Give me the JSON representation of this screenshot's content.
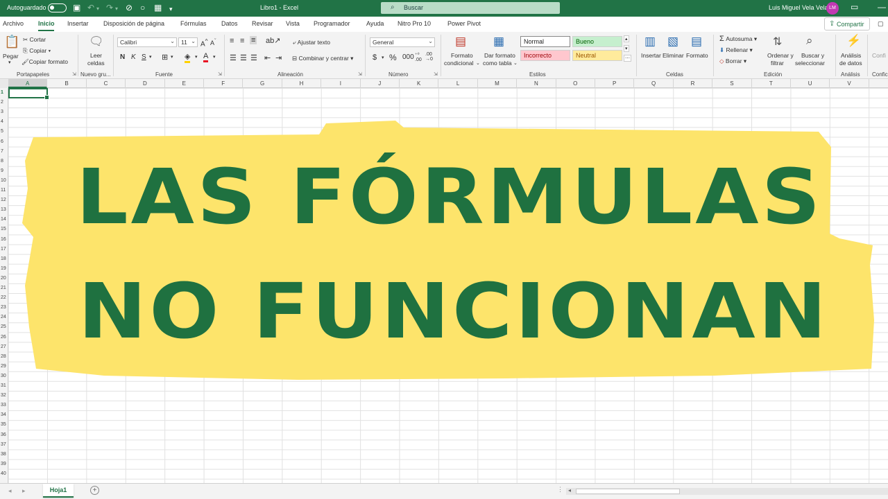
{
  "titlebar": {
    "autosave_label": "Autoguardado",
    "doc_title": "Libro1  -  Excel",
    "search_placeholder": "Buscar",
    "user_name": "Luis Miguel Vela Vela",
    "avatar_initials": "LM"
  },
  "tabs": [
    "Archivo",
    "Inicio",
    "Insertar",
    "Disposición de página",
    "Fórmulas",
    "Datos",
    "Revisar",
    "Vista",
    "Programador",
    "Ayuda",
    "Nitro Pro 10",
    "Power Pivot"
  ],
  "active_tab": "Inicio",
  "share_label": "Compartir",
  "ribbon": {
    "clipboard": {
      "paste": "Pegar",
      "cut": "Cortar",
      "copy": "Copiar",
      "format_painter": "Copiar formato",
      "group": "Portapapeles"
    },
    "new_group": {
      "read_cells_1": "Leer",
      "read_cells_2": "celdas",
      "group": "Nuevo gru..."
    },
    "font": {
      "font_name": "Calibri",
      "font_size": "11",
      "bold": "N",
      "italic": "K",
      "underline": "S",
      "group": "Fuente"
    },
    "alignment": {
      "wrap": "Ajustar texto",
      "merge": "Combinar y centrar",
      "group": "Alineación"
    },
    "number": {
      "format": "General",
      "group": "Número"
    },
    "styles": {
      "cond_format_1": "Formato",
      "cond_format_2": "condicional",
      "table_format_1": "Dar formato",
      "table_format_2": "como tabla",
      "normal": "Normal",
      "good": "Bueno",
      "bad": "Incorrecto",
      "neutral": "Neutral",
      "group": "Estilos"
    },
    "cells": {
      "insert": "Insertar",
      "delete": "Eliminar",
      "format": "Formato",
      "group": "Celdas"
    },
    "editing": {
      "autosum": "Autosuma",
      "fill": "Rellenar",
      "clear": "Borrar",
      "sort_1": "Ordenar y",
      "sort_2": "filtrar",
      "find_1": "Buscar y",
      "find_2": "seleccionar",
      "group": "Edición"
    },
    "analysis": {
      "analyze_1": "Análisis",
      "analyze_2": "de datos",
      "group": "Análisis"
    },
    "confidentiality": {
      "cut_label": "Confi",
      "group": "Confic"
    }
  },
  "columns": [
    "A",
    "B",
    "C",
    "D",
    "E",
    "F",
    "G",
    "H",
    "I",
    "J",
    "K",
    "L",
    "M",
    "N",
    "O",
    "P",
    "Q",
    "R",
    "S",
    "T",
    "U",
    "V"
  ],
  "rows": [
    "1",
    "2",
    "3",
    "4",
    "5",
    "6",
    "7",
    "8",
    "9",
    "10",
    "11",
    "12",
    "13",
    "14",
    "15",
    "16",
    "17",
    "18",
    "19",
    "20",
    "21",
    "22",
    "23",
    "24",
    "25",
    "26",
    "27",
    "28",
    "29",
    "30",
    "31",
    "32",
    "33",
    "34",
    "35",
    "36",
    "37",
    "38",
    "39",
    "40"
  ],
  "banner": {
    "line1": "LAS FÓRMULAS",
    "line2": "NO FUNCIONAN",
    "text_color": "#1f7140",
    "bg_color": "#fde46b"
  },
  "sheet_tab": "Hoja1",
  "colors": {
    "brand": "#217346"
  }
}
